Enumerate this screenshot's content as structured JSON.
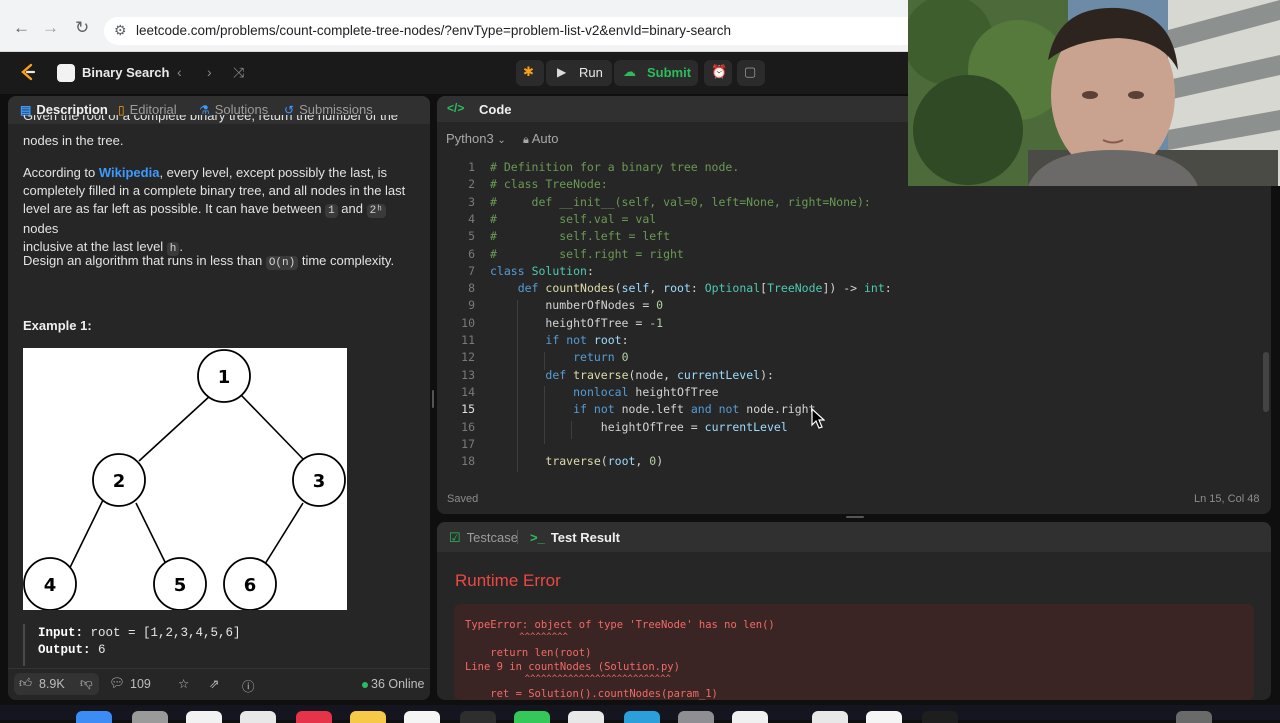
{
  "browser": {
    "url": "leetcode.com/problems/count-complete-tree-nodes/?envType=problem-list-v2&envId=binary-search"
  },
  "header": {
    "list_title": "Binary Search",
    "run_label": "Run",
    "submit_label": "Submit"
  },
  "left_tabs": [
    {
      "label": "Description"
    },
    {
      "label": "Editorial"
    },
    {
      "label": "Solutions"
    },
    {
      "label": "Submissions"
    }
  ],
  "description": {
    "cut_line": "Given the root of a complete binary tree, return the number of the",
    "line1": "nodes in the tree.",
    "p2_a": "According to ",
    "p2_link": "Wikipedia",
    "p2_b": ", every level, except possibly the last, is",
    "p2_c": "completely filled in a complete binary tree, and all nodes in the last",
    "p2_d": "level are as far left as possible. It can have between ",
    "p2_one": "1",
    "p2_and": " and ",
    "p2_pow": "2ʰ",
    "p2_e": " nodes",
    "p2_f": "inclusive at the last level ",
    "p2_h": "h",
    "p2_dot": ".",
    "p3_a": "Design an algorithm that runs in less than ",
    "p3_code": "O(n)",
    "p3_b": " time complexity.",
    "example_title": "Example 1:",
    "tree_nodes": [
      "1",
      "2",
      "3",
      "4",
      "5",
      "6"
    ],
    "input_label": "Input:",
    "input_value": " root = [1,2,3,4,5,6]",
    "output_label": "Output:",
    "output_value": " 6"
  },
  "left_footer": {
    "likes": "8.9K",
    "comments": "109",
    "online": "36 Online"
  },
  "code_panel": {
    "title": "Code",
    "language": "Python3",
    "mode": "Auto",
    "saved": "Saved",
    "cursor_pos": "Ln 15, Col 48",
    "current_line": 15
  },
  "code_lines": [
    "# Definition for a binary tree node.",
    "# class TreeNode:",
    "#     def __init__(self, val=0, left=None, right=None):",
    "#         self.val = val",
    "#         self.left = left",
    "#         self.right = right",
    "class Solution:",
    "    def countNodes(self, root: Optional[TreeNode]) -> int:",
    "        numberOfNodes = 0",
    "        heightOfTree = -1",
    "        if not root:",
    "            return 0",
    "        def traverse(node, currentLevel):",
    "            nonlocal heightOfTree",
    "            if not node.left and not node.right",
    "                heightOfTree = currentLevel",
    "",
    "        traverse(root, 0)"
  ],
  "result_panel": {
    "tab_testcase": "Testcase",
    "tab_result": "Test Result",
    "error_title": "Runtime Error",
    "error_lines": [
      "TypeError: object of type 'TreeNode' has no len()",
      "          ^^^^^^^^^",
      "    return len(root)",
      "Line 9 in countNodes (Solution.py)",
      "           ^^^^^^^^^^^^^^^^^^^^^^^^^^^",
      "    ret = Solution().countNodes(param_1)"
    ]
  },
  "colors": {
    "accent_blue": "#3b9bff",
    "run_green": "#2cbb5d",
    "error_red": "#ef4743"
  }
}
